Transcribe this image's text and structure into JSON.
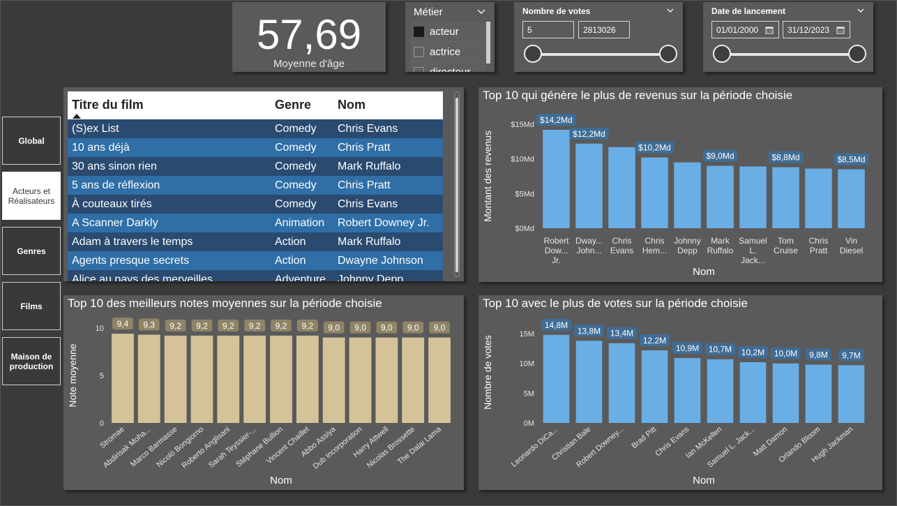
{
  "kpi": {
    "value": "57,69",
    "label": "Moyenne d'âge"
  },
  "metier": {
    "title": "Métier",
    "items": [
      {
        "label": "acteur",
        "checked": true
      },
      {
        "label": "actrice",
        "checked": false
      },
      {
        "label": "directeur",
        "checked": false
      }
    ]
  },
  "votes_slicer": {
    "title": "Nombre de votes",
    "min": "5",
    "max": "2813026"
  },
  "date_slicer": {
    "title": "Date de lancement",
    "start": "01/01/2000",
    "end": "31/12/2023"
  },
  "nav": [
    "Global",
    "Acteurs et Réalisateurs",
    "Genres",
    "Films",
    "Maison de production"
  ],
  "table": {
    "headers": [
      "Titre du film",
      "Genre",
      "Nom"
    ],
    "rows": [
      [
        "(S)ex List",
        "Comedy",
        "Chris Evans"
      ],
      [
        "10 ans déjà",
        "Comedy",
        "Chris Pratt"
      ],
      [
        "30 ans sinon rien",
        "Comedy",
        "Mark Ruffalo"
      ],
      [
        "5 ans de réflexion",
        "Comedy",
        "Chris Pratt"
      ],
      [
        "À couteaux tirés",
        "Comedy",
        "Chris Evans"
      ],
      [
        "A Scanner Darkly",
        "Animation",
        "Robert Downey Jr."
      ],
      [
        "Adam à travers le temps",
        "Action",
        "Mark Ruffalo"
      ],
      [
        "Agents presque secrets",
        "Action",
        "Dwayne Johnson"
      ],
      [
        "Alice au pays des merveilles",
        "Adventure",
        "Johnny Depp"
      ]
    ]
  },
  "chart_data": [
    {
      "type": "bar",
      "title": "Top 10 qui génère le plus de revenus sur la période choisie",
      "xlabel": "Nom",
      "ylabel": "Montant des revenus",
      "categories": [
        "Robert Dow... Jr.",
        "Dway... John...",
        "Chris Evans",
        "Chris Hem...",
        "Johnny Depp",
        "Mark Ruffalo",
        "Samuel L. Jack...",
        "Tom Cruise",
        "Chris Pratt",
        "Vin Diesel"
      ],
      "values": [
        14.2,
        12.2,
        11.7,
        10.2,
        9.5,
        9.0,
        8.9,
        8.8,
        8.6,
        8.5
      ],
      "data_labels": [
        "$14,2Md",
        "$12,2Md",
        "",
        "$10,2Md",
        "",
        "$9,0Md",
        "",
        "$8,8Md",
        "",
        "$8,5Md"
      ],
      "yticks": [
        0,
        5,
        10,
        15
      ],
      "ytick_labels": [
        "$0Md",
        "$5Md",
        "$10Md",
        "$15Md"
      ],
      "ylim": [
        0,
        15
      ],
      "color": "#6aaee6",
      "label_bg": "#3f6d96"
    },
    {
      "type": "bar",
      "title": "Top 10 des meilleurs notes moyennes sur la période choisie",
      "xlabel": "Nom",
      "ylabel": "Note moyenne",
      "categories": [
        "Stromae",
        "Abdirisak Moha...",
        "Marco Barmasse",
        "Nicolò Bongiorno",
        "Roberto Anglisani",
        "Sarah Teyssier-...",
        "Stéphane Bullion",
        "Vincent Chaillet",
        "Abbo Assiya",
        "Dub Incorporation",
        "Harry Attwell",
        "Nicolas Brossette",
        "The Dalai Lama"
      ],
      "values": [
        9.4,
        9.3,
        9.2,
        9.2,
        9.2,
        9.2,
        9.2,
        9.2,
        9.0,
        9.0,
        9.0,
        9.0,
        9.0
      ],
      "data_labels": [
        "9,4",
        "9,3",
        "9,2",
        "9,2",
        "9,2",
        "9,2",
        "9,2",
        "9,2",
        "9,0",
        "9,0",
        "9,0",
        "9,0",
        "9,0"
      ],
      "yticks": [
        0,
        5,
        10
      ],
      "ytick_labels": [
        "0",
        "5",
        "10"
      ],
      "ylim": [
        0,
        10
      ],
      "color": "#d4c398",
      "label_bg": "#8f8566"
    },
    {
      "type": "bar",
      "title": "Top 10 avec le plus de votes sur la période choisie",
      "xlabel": "Nom",
      "ylabel": "Nombre de votes",
      "categories": [
        "Leonardo DiCa...",
        "Christian Bale",
        "Robert Downey...",
        "Brad Pitt",
        "Chris Evans",
        "Ian McKellen",
        "Samuel L. Jack...",
        "Matt Damon",
        "Orlando Bloom",
        "Hugh Jackman"
      ],
      "values": [
        14.8,
        13.8,
        13.4,
        12.2,
        10.9,
        10.7,
        10.2,
        10.0,
        9.8,
        9.7
      ],
      "data_labels": [
        "14,8M",
        "13,8M",
        "13,4M",
        "12,2M",
        "10,9M",
        "10,7M",
        "10,2M",
        "10,0M",
        "9,8M",
        "9,7M"
      ],
      "yticks": [
        0,
        5,
        10,
        15
      ],
      "ytick_labels": [
        "0M",
        "5M",
        "10M",
        "15M"
      ],
      "ylim": [
        0,
        17
      ],
      "color": "#6aaee6",
      "label_bg": "#3f6d96"
    }
  ]
}
